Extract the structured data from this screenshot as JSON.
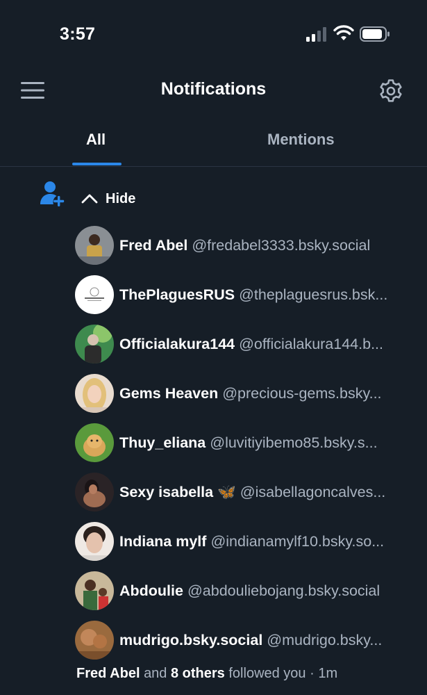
{
  "status_bar": {
    "time": "3:57"
  },
  "header": {
    "title": "Notifications",
    "menu_icon": "hamburger-menu-icon",
    "settings_icon": "gear-icon"
  },
  "tabs": [
    {
      "label": "All",
      "active": true
    },
    {
      "label": "Mentions",
      "active": false
    }
  ],
  "notification": {
    "icon": "person-add-icon",
    "toggle_label": "Hide",
    "followers": [
      {
        "name": "Fred Abel",
        "handle": "@fredabel3333.bsky.social"
      },
      {
        "name": "ThePlaguesRUS",
        "handle": "@theplaguesrus.bsk..."
      },
      {
        "name": "Officialakura144",
        "handle": "@officialakura144.b..."
      },
      {
        "name": "Gems Heaven",
        "handle": "@precious-gems.bsky..."
      },
      {
        "name": "Thuy_eliana",
        "handle": "@luvitiyibemo85.bsky.s..."
      },
      {
        "name": "Sexy isabella 🦋",
        "handle": "@isabellagoncalves..."
      },
      {
        "name": "Indiana mylf",
        "handle": "@indianamylf10.bsky.so..."
      },
      {
        "name": "Abdoulie",
        "handle": "@abdouliebojang.bsky.social"
      },
      {
        "name": "mudrigo.bsky.social",
        "handle": "@mudrigo.bsky..."
      }
    ],
    "summary": {
      "first_name": "Fred Abel",
      "connector": "and",
      "others": "8 others",
      "action": "followed you",
      "separator": "·",
      "time": "1m"
    }
  },
  "colors": {
    "background": "#161e27",
    "accent": "#2b87e8",
    "muted_text": "#aab4c1"
  }
}
